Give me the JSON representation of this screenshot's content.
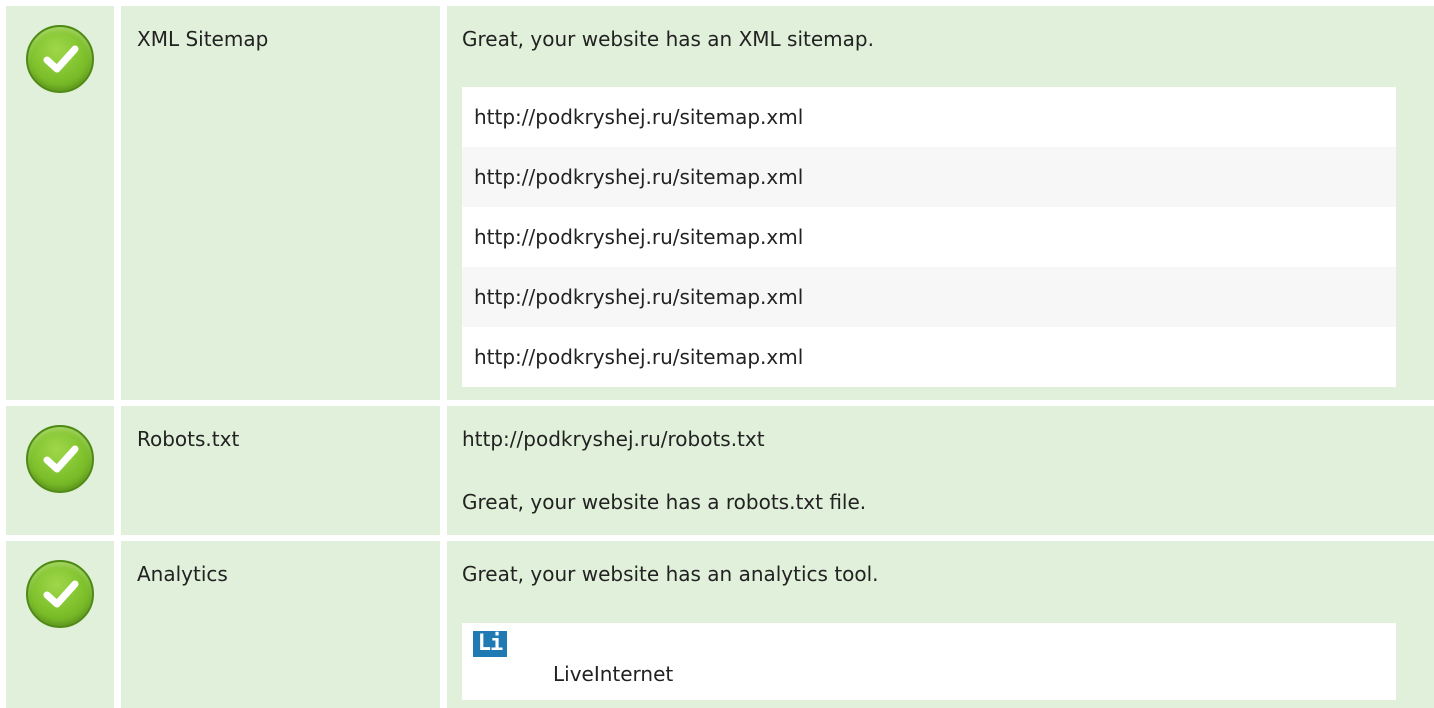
{
  "rows": [
    {
      "status": "pass",
      "label": "XML Sitemap",
      "message": "Great, your website has an XML sitemap.",
      "sitemaps": [
        "http://podkryshej.ru/sitemap.xml",
        "http://podkryshej.ru/sitemap.xml",
        "http://podkryshej.ru/sitemap.xml",
        "http://podkryshej.ru/sitemap.xml",
        "http://podkryshej.ru/sitemap.xml"
      ]
    },
    {
      "status": "pass",
      "label": "Robots.txt",
      "url": "http://podkryshej.ru/robots.txt",
      "message": "Great, your website has a robots.txt file."
    },
    {
      "status": "pass",
      "label": "Analytics",
      "message": "Great, your website has an analytics tool.",
      "tools": [
        {
          "logo_text": "Li",
          "name": "LiveInternet"
        }
      ]
    }
  ],
  "icons": {
    "status_icon": "check-circle-icon",
    "tool_logo": "liveinternet-logo-icon"
  },
  "colors": {
    "row_background": "#e1f0da",
    "pass_green": "#7cbf2a",
    "list_background": "#ffffff",
    "list_alt_background": "#f7f7f7",
    "liveinternet_blue": "#1f79b3"
  }
}
